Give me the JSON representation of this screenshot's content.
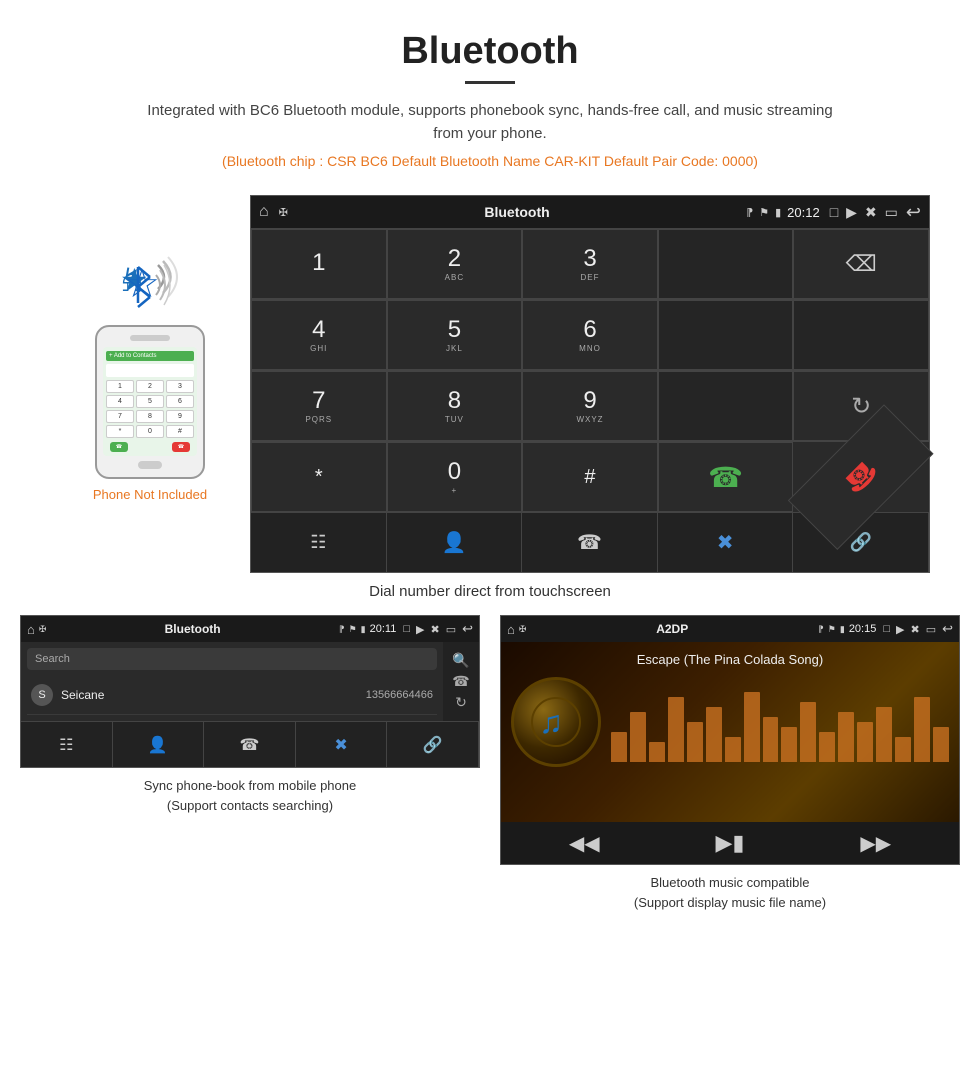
{
  "page": {
    "title": "Bluetooth",
    "subtitle": "Integrated with BC6 Bluetooth module, supports phonebook sync, hands-free call, and music streaming from your phone.",
    "bt_info": "(Bluetooth chip : CSR BC6    Default Bluetooth Name CAR-KIT    Default Pair Code: 0000)",
    "caption_main": "Dial number direct from touchscreen",
    "phone_not_included": "Phone Not Included"
  },
  "head_unit": {
    "screen_title": "Bluetooth",
    "time": "20:12",
    "dialpad": {
      "keys": [
        {
          "main": "1",
          "sub": ""
        },
        {
          "main": "2",
          "sub": "ABC"
        },
        {
          "main": "3",
          "sub": "DEF"
        },
        {
          "main": "",
          "sub": ""
        },
        {
          "main": "⌫",
          "sub": ""
        },
        {
          "main": "4",
          "sub": "GHI"
        },
        {
          "main": "5",
          "sub": "JKL"
        },
        {
          "main": "6",
          "sub": "MNO"
        },
        {
          "main": "",
          "sub": ""
        },
        {
          "main": "",
          "sub": ""
        },
        {
          "main": "7",
          "sub": "PQRS"
        },
        {
          "main": "8",
          "sub": "TUV"
        },
        {
          "main": "9",
          "sub": "WXYZ"
        },
        {
          "main": "",
          "sub": ""
        },
        {
          "main": "↻",
          "sub": ""
        },
        {
          "main": "*",
          "sub": ""
        },
        {
          "main": "0",
          "sub": "+"
        },
        {
          "main": "#",
          "sub": ""
        },
        {
          "main": "📞",
          "sub": ""
        },
        {
          "main": "📞",
          "sub": "end"
        }
      ]
    },
    "bottom_icons": [
      "⊞",
      "👤",
      "📞",
      "✱",
      "🔗"
    ]
  },
  "phonebook_screen": {
    "title": "Bluetooth",
    "time": "20:11",
    "search_placeholder": "Search",
    "contact": {
      "initial": "S",
      "name": "Seicane",
      "number": "13566664466"
    },
    "caption": "Sync phone-book from mobile phone\n(Support contacts searching)"
  },
  "music_screen": {
    "title": "A2DP",
    "time": "20:15",
    "song_title": "Escape (The Pina Colada Song)",
    "caption": "Bluetooth music compatible\n(Support display music file name)",
    "eq_heights": [
      30,
      50,
      20,
      65,
      40,
      55,
      25,
      70,
      45,
      35,
      60,
      30,
      50,
      40,
      55,
      25,
      65,
      35
    ]
  },
  "colors": {
    "orange": "#e87722",
    "green": "#4CAF50",
    "red": "#e53935",
    "blue": "#1a6fba",
    "dark_bg": "#2a2a2a",
    "darker_bg": "#1a1a1a"
  }
}
